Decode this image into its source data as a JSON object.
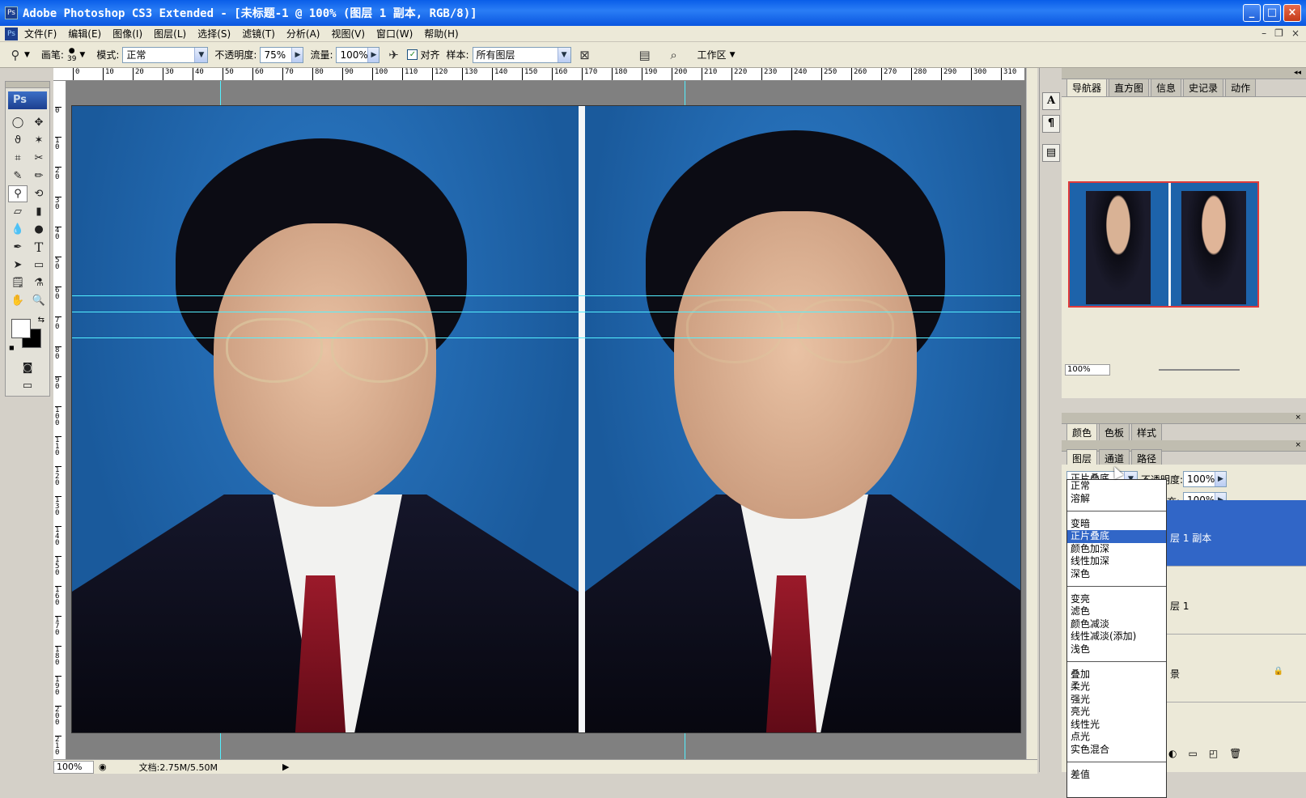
{
  "window": {
    "title": "Adobe Photoshop CS3 Extended - [未标题-1 @ 100% (图层 1 副本, RGB/8)]"
  },
  "menu": [
    "文件(F)",
    "编辑(E)",
    "图像(I)",
    "图层(L)",
    "选择(S)",
    "滤镜(T)",
    "分析(A)",
    "视图(V)",
    "窗口(W)",
    "帮助(H)"
  ],
  "options": {
    "brush_label": "画笔:",
    "brush_size": "39",
    "mode_label": "模式:",
    "mode_value": "正常",
    "opacity_label": "不透明度:",
    "opacity_value": "75%",
    "flow_label": "流量:",
    "flow_value": "100%",
    "aligned_label": "对齐",
    "sample_label": "样本:",
    "sample_value": "所有图层",
    "workspace_label": "工作区"
  },
  "ruler": {
    "h_ticks": [
      "0",
      "10",
      "20",
      "30",
      "40",
      "50",
      "60",
      "70",
      "80",
      "90",
      "100",
      "110",
      "120",
      "130",
      "140",
      "150",
      "160",
      "170",
      "180",
      "190",
      "200",
      "210",
      "220",
      "230",
      "240",
      "250",
      "260",
      "270",
      "280",
      "290",
      "300",
      "310"
    ],
    "v_ticks": [
      "0",
      "1 0",
      "2 0",
      "3 0",
      "4 0",
      "5 0",
      "6 0",
      "7 0",
      "8 0",
      "9 0",
      "1 0 0",
      "1 1 0",
      "1 2 0",
      "1 3 0",
      "1 4 0",
      "1 5 0",
      "1 6 0",
      "1 7 0",
      "1 8 0",
      "1 9 0",
      "2 0 0",
      "2 1 0"
    ]
  },
  "status": {
    "zoom": "100%",
    "doc": "文档:2.75M/5.50M"
  },
  "panels": {
    "nav_tabs": [
      "导航器",
      "直方图",
      "信息",
      "史记录",
      "动作"
    ],
    "nav_zoom": "100%",
    "color_tabs": [
      "颜色",
      "色板",
      "样式"
    ],
    "layer_tabs": [
      "图层",
      "通道",
      "路径"
    ],
    "blend_value": "正片叠底",
    "opacity_label": "不透明度:",
    "opacity_value": "100%",
    "fill_label": "充:",
    "fill_value": "100%",
    "layers": [
      "层 1 副本",
      "层 1",
      "景"
    ]
  },
  "dropdown": {
    "items": [
      "正常",
      "溶解",
      "",
      "变暗",
      "正片叠底",
      "颜色加深",
      "线性加深",
      "深色",
      "",
      "变亮",
      "滤色",
      "颜色减淡",
      "线性减淡(添加)",
      "浅色",
      "",
      "叠加",
      "柔光",
      "强光",
      "亮光",
      "线性光",
      "点光",
      "实色混合",
      "",
      "差值"
    ],
    "selected": "正片叠底"
  },
  "colors": {
    "guide": "#54f0ff",
    "selection": "#3166c7",
    "nav_frame": "#e03a3a"
  }
}
